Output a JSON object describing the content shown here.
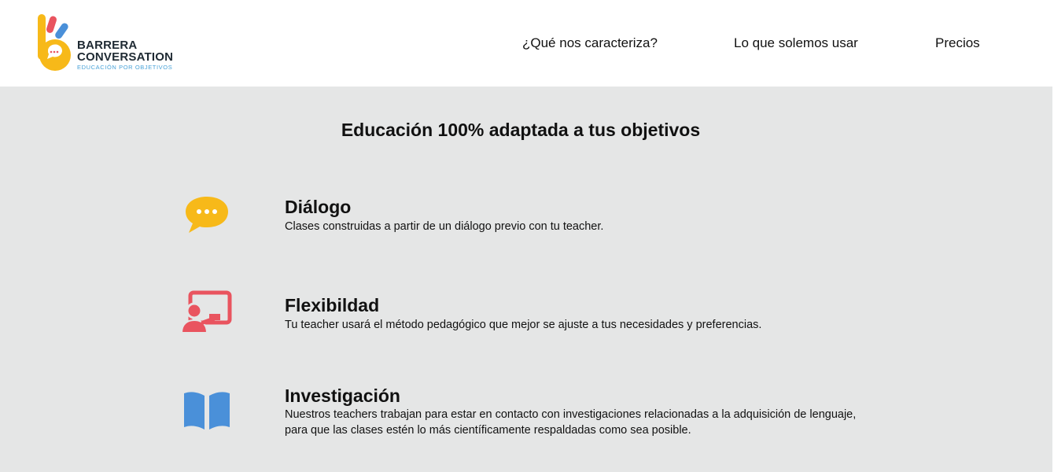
{
  "brand": {
    "line1": "BARRERA",
    "line2": "CONVERSATION",
    "tagline": "EDUCACIÓN POR OBJETIVOS",
    "colors": {
      "yellow": "#f7b919",
      "red": "#e9545f",
      "blue": "#4a90d9",
      "dark": "#1f2a33"
    }
  },
  "nav": {
    "items": [
      {
        "label": "¿Qué nos caracteriza?"
      },
      {
        "label": "Lo que solemos usar"
      },
      {
        "label": "Precios"
      }
    ]
  },
  "main": {
    "title": "Educación 100% adaptada a tus objetivos",
    "features": [
      {
        "icon": "chat-bubble-icon",
        "color": "#f7b919",
        "title": "Diálogo",
        "description": "Clases construidas a partir de un diálogo previo con tu teacher."
      },
      {
        "icon": "teacher-board-icon",
        "color": "#e9545f",
        "title": "Flexibildad",
        "description": "Tu teacher usará el método pedagógico que mejor se ajuste a tus necesidades y preferencias."
      },
      {
        "icon": "open-book-icon",
        "color": "#4a90d9",
        "title": "Investigación",
        "description_line1": "Nuestros teachers trabajan para estar en contacto con investigaciones relacionadas a la adquisición de lenguaje,",
        "description_line2": "para que las clases estén lo más científicamente respaldadas como sea posible."
      }
    ]
  }
}
